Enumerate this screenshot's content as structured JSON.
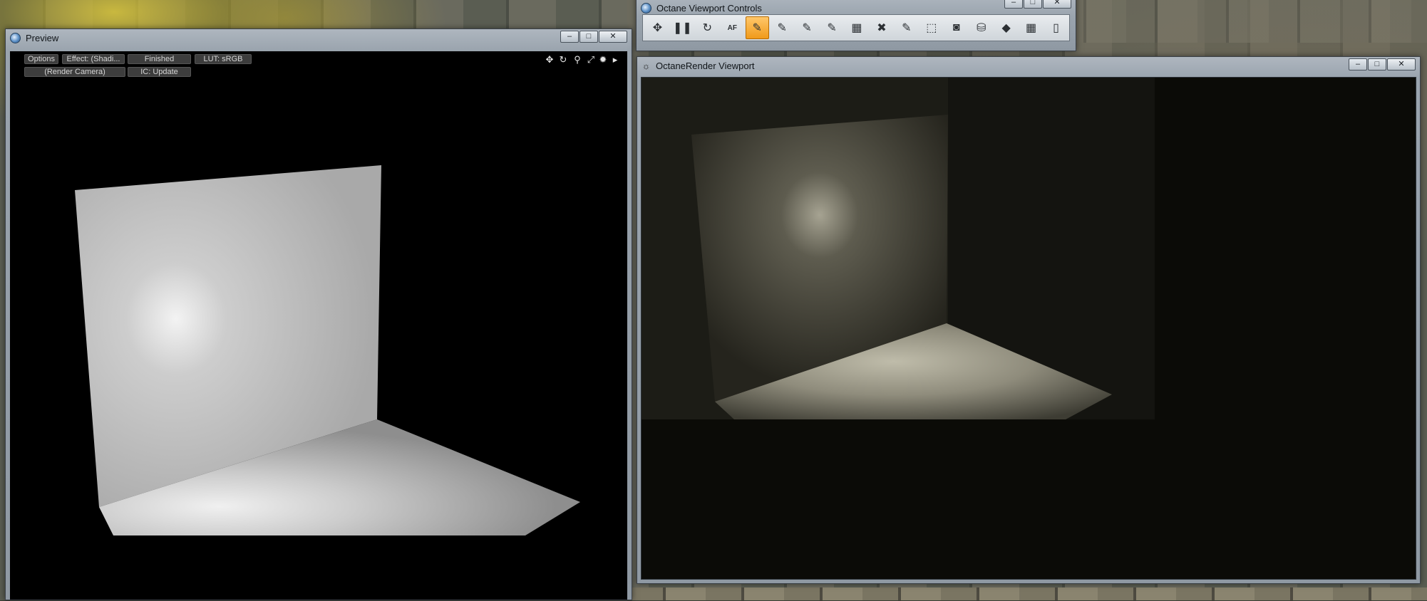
{
  "preview": {
    "title": "Preview",
    "buttons": {
      "options": "Options",
      "effect": "Effect: (Shadi...",
      "status": "Finished",
      "lut": "LUT: sRGB",
      "camera": "(Render Camera)",
      "ic": "IC: Update"
    },
    "tools": [
      "move-icon",
      "rotate-icon",
      "zoom-icon",
      "fit-icon",
      "settings-icon",
      "play-icon"
    ]
  },
  "controls": {
    "title": "Octane Viewport Controls",
    "toolbar": [
      {
        "name": "fit-view-icon",
        "glyph": "✥",
        "active": false
      },
      {
        "name": "pause-icon",
        "glyph": "❚❚",
        "active": false
      },
      {
        "name": "restart-icon",
        "glyph": "↻",
        "active": false
      },
      {
        "name": "autofocus-icon",
        "label": "AF",
        "active": false
      },
      {
        "name": "pick-focus-icon",
        "glyph": "✎",
        "active": true
      },
      {
        "name": "pick-white-balance-icon",
        "glyph": "✎",
        "active": false
      },
      {
        "name": "pick-material-icon",
        "glyph": "✎",
        "active": false
      },
      {
        "name": "pick-object-icon",
        "glyph": "✎",
        "active": false
      },
      {
        "name": "region-render-icon",
        "glyph": "▦",
        "active": false
      },
      {
        "name": "clear-region-icon",
        "glyph": "✖",
        "active": false
      },
      {
        "name": "pick-camera-icon",
        "glyph": "✎",
        "active": false
      },
      {
        "name": "zoom-region-icon",
        "glyph": "⬚",
        "active": false
      },
      {
        "name": "snapshot-icon",
        "glyph": "◙",
        "active": false
      },
      {
        "name": "save-image-icon",
        "glyph": "⛁",
        "active": false
      },
      {
        "name": "material-icon",
        "glyph": "◆",
        "active": false
      },
      {
        "name": "color-palette-icon",
        "glyph": "▦",
        "active": false
      },
      {
        "name": "device-icon",
        "glyph": "▯",
        "active": false
      }
    ]
  },
  "render": {
    "title": "OctaneRender Viewport"
  },
  "window_controls": {
    "minimize": "–",
    "maximize": "□",
    "close": "✕"
  }
}
